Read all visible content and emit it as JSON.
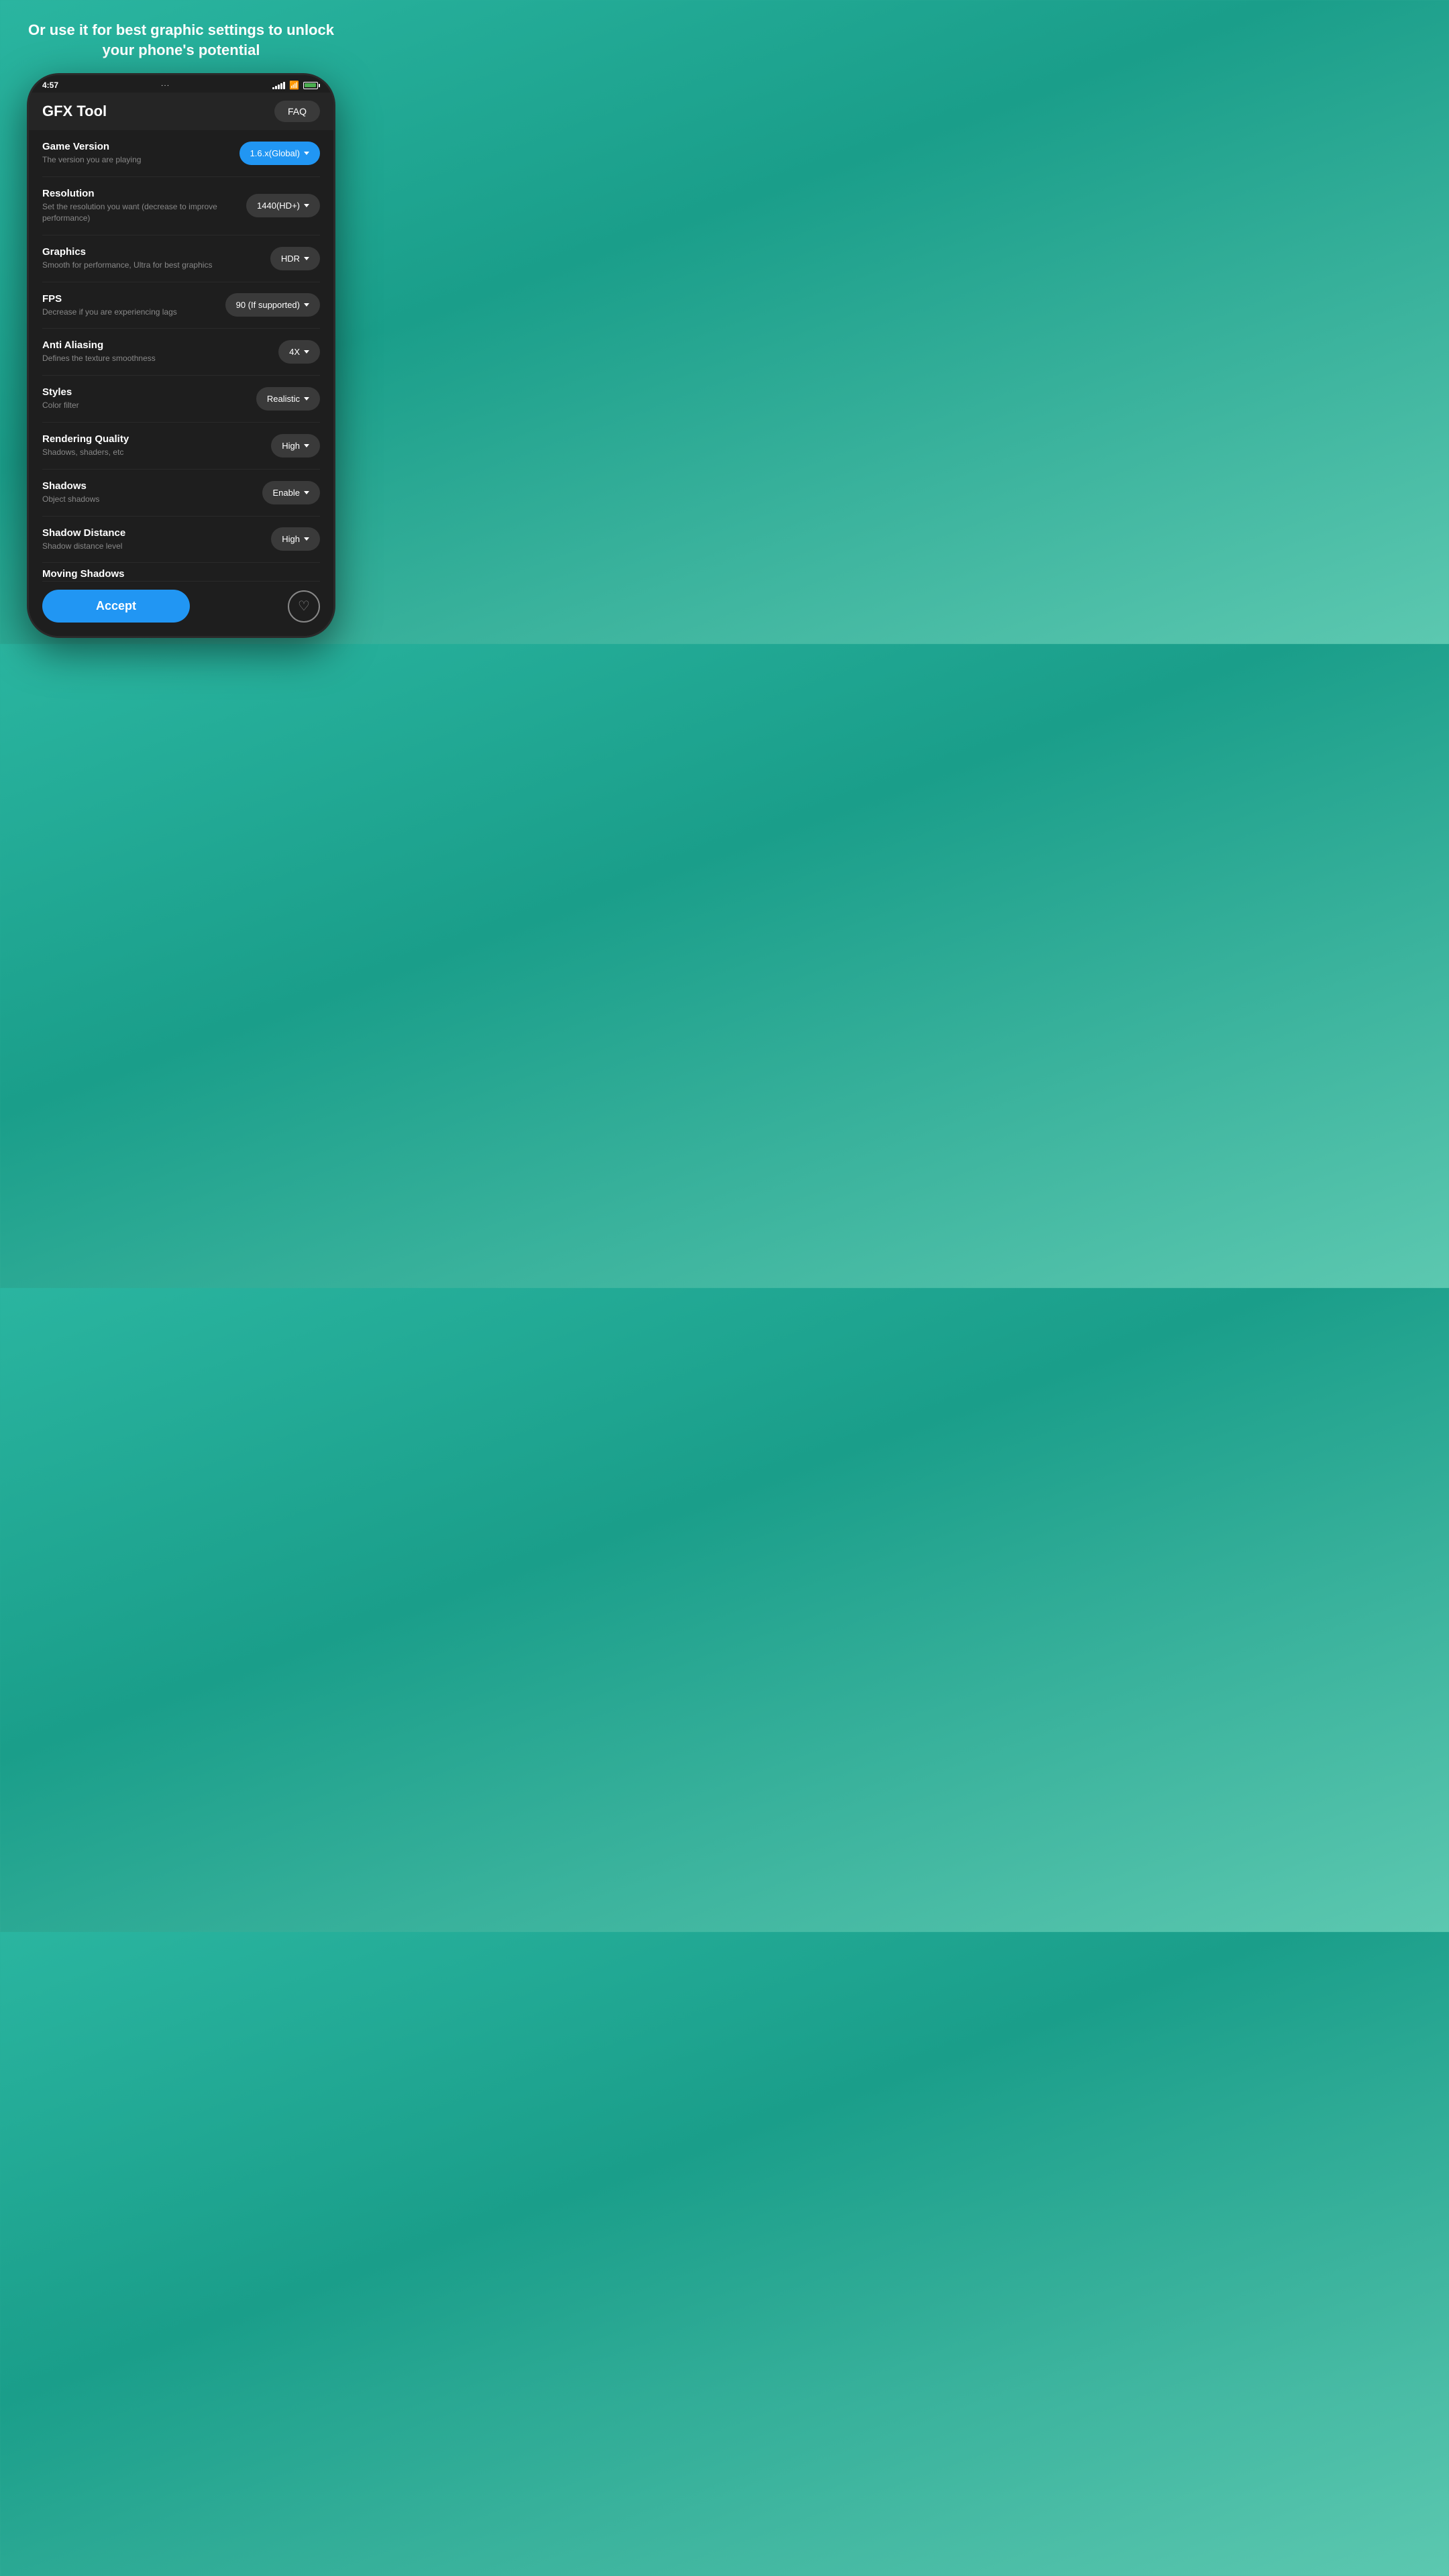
{
  "header": {
    "tagline": "Or use it for best graphic settings to unlock your phone's potential"
  },
  "statusBar": {
    "time": "4:57",
    "dots": "···"
  },
  "appHeader": {
    "title": "GFX Tool",
    "faqLabel": "FAQ"
  },
  "settings": [
    {
      "id": "game-version",
      "title": "Game Version",
      "desc": "The version you are playing",
      "value": "1.6.x(Global)",
      "isBlue": true
    },
    {
      "id": "resolution",
      "title": "Resolution",
      "desc": "Set the resolution you want (decrease to improve performance)",
      "value": "1440(HD+)",
      "isBlue": false
    },
    {
      "id": "graphics",
      "title": "Graphics",
      "desc": "Smooth for performance, Ultra for best graphics",
      "value": "HDR",
      "isBlue": false
    },
    {
      "id": "fps",
      "title": "FPS",
      "desc": "Decrease if you are experiencing lags",
      "value": "90 (If supported)",
      "isBlue": false
    },
    {
      "id": "anti-aliasing",
      "title": "Anti Aliasing",
      "desc": "Defines the texture smoothness",
      "value": "4X",
      "isBlue": false
    },
    {
      "id": "styles",
      "title": "Styles",
      "desc": "Color filter",
      "value": "Realistic",
      "isBlue": false
    },
    {
      "id": "rendering-quality",
      "title": "Rendering Quality",
      "desc": "Shadows, shaders, etc",
      "value": "High",
      "isBlue": false
    },
    {
      "id": "shadows",
      "title": "Shadows",
      "desc": "Object shadows",
      "value": "Enable",
      "isBlue": false
    },
    {
      "id": "shadow-distance",
      "title": "Shadow Distance",
      "desc": "Shadow distance level",
      "value": "High",
      "isBlue": false
    },
    {
      "id": "moving-shadows",
      "title": "Moving Shadows",
      "desc": "",
      "value": "",
      "isBlue": false,
      "partial": true
    }
  ],
  "bottomBar": {
    "acceptLabel": "Accept",
    "heartLabel": "♡"
  }
}
